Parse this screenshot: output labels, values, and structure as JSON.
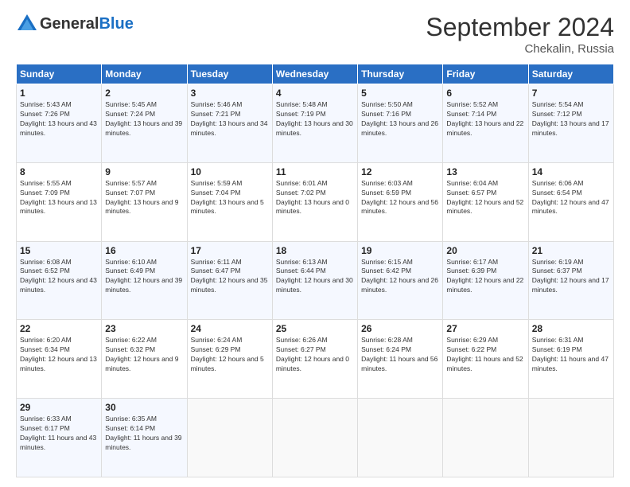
{
  "header": {
    "logo_line1": "General",
    "logo_line2": "Blue",
    "month": "September 2024",
    "location": "Chekalin, Russia"
  },
  "weekdays": [
    "Sunday",
    "Monday",
    "Tuesday",
    "Wednesday",
    "Thursday",
    "Friday",
    "Saturday"
  ],
  "weeks": [
    [
      {
        "day": "1",
        "sunrise": "Sunrise: 5:43 AM",
        "sunset": "Sunset: 7:26 PM",
        "daylight": "Daylight: 13 hours and 43 minutes."
      },
      {
        "day": "2",
        "sunrise": "Sunrise: 5:45 AM",
        "sunset": "Sunset: 7:24 PM",
        "daylight": "Daylight: 13 hours and 39 minutes."
      },
      {
        "day": "3",
        "sunrise": "Sunrise: 5:46 AM",
        "sunset": "Sunset: 7:21 PM",
        "daylight": "Daylight: 13 hours and 34 minutes."
      },
      {
        "day": "4",
        "sunrise": "Sunrise: 5:48 AM",
        "sunset": "Sunset: 7:19 PM",
        "daylight": "Daylight: 13 hours and 30 minutes."
      },
      {
        "day": "5",
        "sunrise": "Sunrise: 5:50 AM",
        "sunset": "Sunset: 7:16 PM",
        "daylight": "Daylight: 13 hours and 26 minutes."
      },
      {
        "day": "6",
        "sunrise": "Sunrise: 5:52 AM",
        "sunset": "Sunset: 7:14 PM",
        "daylight": "Daylight: 13 hours and 22 minutes."
      },
      {
        "day": "7",
        "sunrise": "Sunrise: 5:54 AM",
        "sunset": "Sunset: 7:12 PM",
        "daylight": "Daylight: 13 hours and 17 minutes."
      }
    ],
    [
      {
        "day": "8",
        "sunrise": "Sunrise: 5:55 AM",
        "sunset": "Sunset: 7:09 PM",
        "daylight": "Daylight: 13 hours and 13 minutes."
      },
      {
        "day": "9",
        "sunrise": "Sunrise: 5:57 AM",
        "sunset": "Sunset: 7:07 PM",
        "daylight": "Daylight: 13 hours and 9 minutes."
      },
      {
        "day": "10",
        "sunrise": "Sunrise: 5:59 AM",
        "sunset": "Sunset: 7:04 PM",
        "daylight": "Daylight: 13 hours and 5 minutes."
      },
      {
        "day": "11",
        "sunrise": "Sunrise: 6:01 AM",
        "sunset": "Sunset: 7:02 PM",
        "daylight": "Daylight: 13 hours and 0 minutes."
      },
      {
        "day": "12",
        "sunrise": "Sunrise: 6:03 AM",
        "sunset": "Sunset: 6:59 PM",
        "daylight": "Daylight: 12 hours and 56 minutes."
      },
      {
        "day": "13",
        "sunrise": "Sunrise: 6:04 AM",
        "sunset": "Sunset: 6:57 PM",
        "daylight": "Daylight: 12 hours and 52 minutes."
      },
      {
        "day": "14",
        "sunrise": "Sunrise: 6:06 AM",
        "sunset": "Sunset: 6:54 PM",
        "daylight": "Daylight: 12 hours and 47 minutes."
      }
    ],
    [
      {
        "day": "15",
        "sunrise": "Sunrise: 6:08 AM",
        "sunset": "Sunset: 6:52 PM",
        "daylight": "Daylight: 12 hours and 43 minutes."
      },
      {
        "day": "16",
        "sunrise": "Sunrise: 6:10 AM",
        "sunset": "Sunset: 6:49 PM",
        "daylight": "Daylight: 12 hours and 39 minutes."
      },
      {
        "day": "17",
        "sunrise": "Sunrise: 6:11 AM",
        "sunset": "Sunset: 6:47 PM",
        "daylight": "Daylight: 12 hours and 35 minutes."
      },
      {
        "day": "18",
        "sunrise": "Sunrise: 6:13 AM",
        "sunset": "Sunset: 6:44 PM",
        "daylight": "Daylight: 12 hours and 30 minutes."
      },
      {
        "day": "19",
        "sunrise": "Sunrise: 6:15 AM",
        "sunset": "Sunset: 6:42 PM",
        "daylight": "Daylight: 12 hours and 26 minutes."
      },
      {
        "day": "20",
        "sunrise": "Sunrise: 6:17 AM",
        "sunset": "Sunset: 6:39 PM",
        "daylight": "Daylight: 12 hours and 22 minutes."
      },
      {
        "day": "21",
        "sunrise": "Sunrise: 6:19 AM",
        "sunset": "Sunset: 6:37 PM",
        "daylight": "Daylight: 12 hours and 17 minutes."
      }
    ],
    [
      {
        "day": "22",
        "sunrise": "Sunrise: 6:20 AM",
        "sunset": "Sunset: 6:34 PM",
        "daylight": "Daylight: 12 hours and 13 minutes."
      },
      {
        "day": "23",
        "sunrise": "Sunrise: 6:22 AM",
        "sunset": "Sunset: 6:32 PM",
        "daylight": "Daylight: 12 hours and 9 minutes."
      },
      {
        "day": "24",
        "sunrise": "Sunrise: 6:24 AM",
        "sunset": "Sunset: 6:29 PM",
        "daylight": "Daylight: 12 hours and 5 minutes."
      },
      {
        "day": "25",
        "sunrise": "Sunrise: 6:26 AM",
        "sunset": "Sunset: 6:27 PM",
        "daylight": "Daylight: 12 hours and 0 minutes."
      },
      {
        "day": "26",
        "sunrise": "Sunrise: 6:28 AM",
        "sunset": "Sunset: 6:24 PM",
        "daylight": "Daylight: 11 hours and 56 minutes."
      },
      {
        "day": "27",
        "sunrise": "Sunrise: 6:29 AM",
        "sunset": "Sunset: 6:22 PM",
        "daylight": "Daylight: 11 hours and 52 minutes."
      },
      {
        "day": "28",
        "sunrise": "Sunrise: 6:31 AM",
        "sunset": "Sunset: 6:19 PM",
        "daylight": "Daylight: 11 hours and 47 minutes."
      }
    ],
    [
      {
        "day": "29",
        "sunrise": "Sunrise: 6:33 AM",
        "sunset": "Sunset: 6:17 PM",
        "daylight": "Daylight: 11 hours and 43 minutes."
      },
      {
        "day": "30",
        "sunrise": "Sunrise: 6:35 AM",
        "sunset": "Sunset: 6:14 PM",
        "daylight": "Daylight: 11 hours and 39 minutes."
      },
      null,
      null,
      null,
      null,
      null
    ]
  ]
}
